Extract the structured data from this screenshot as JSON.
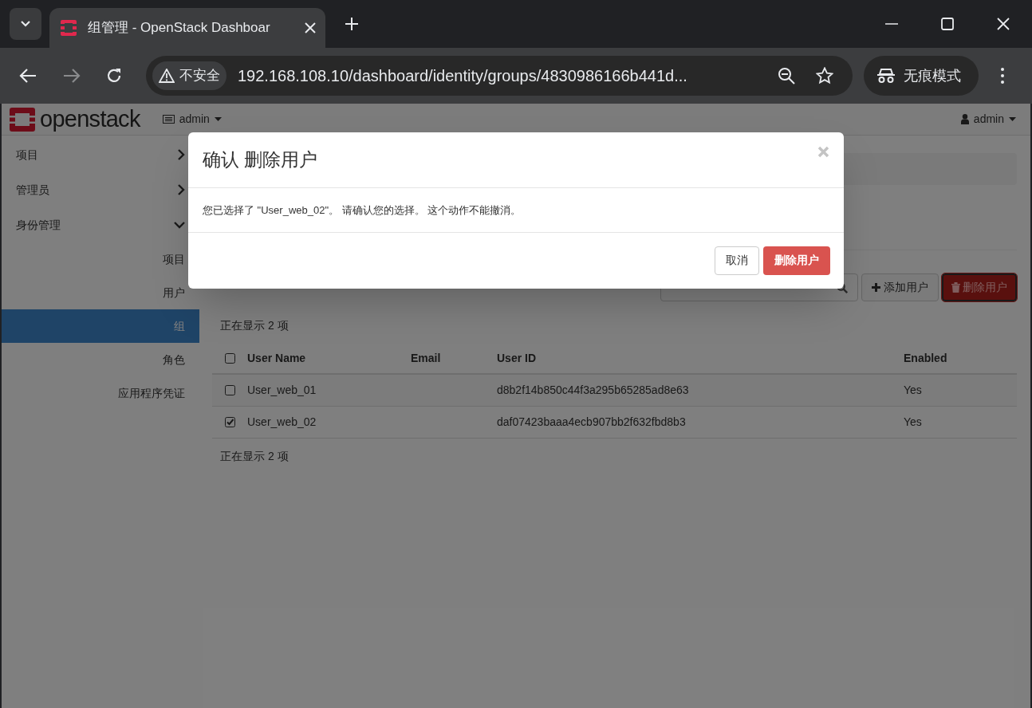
{
  "browser": {
    "tab_title": "组管理 - OpenStack Dashboar",
    "security_label": "不安全",
    "url": "192.168.108.10/dashboard/identity/groups/4830986166b441d...",
    "incognito_label": "无痕模式"
  },
  "header": {
    "logo_text": "openstack",
    "project_menu": "admin",
    "user_menu": "admin"
  },
  "sidebar": {
    "items": [
      {
        "label": "项目",
        "expanded": false
      },
      {
        "label": "管理员",
        "expanded": false
      },
      {
        "label": "身份管理",
        "expanded": true,
        "children": [
          {
            "label": "项目",
            "selected": false
          },
          {
            "label": "用户",
            "selected": false
          },
          {
            "label": "组",
            "selected": true
          },
          {
            "label": "角色",
            "selected": false
          },
          {
            "label": "应用程序凭证",
            "selected": false
          }
        ]
      }
    ]
  },
  "toolbar": {
    "buttons": [
      {
        "kind": "add",
        "label": "添加用户"
      },
      {
        "kind": "delete",
        "label": "删除用户"
      }
    ]
  },
  "table": {
    "count_top": "正在显示 2 项",
    "select_all_checked": false,
    "columns": [
      "User Name",
      "Email",
      "User ID",
      "Enabled"
    ],
    "rows": [
      {
        "selected": false,
        "user_name": "User_web_01",
        "user_id": "d8b2f14b850c44f3a295b65285ad8e63",
        "enabled": "Yes"
      },
      {
        "selected": true,
        "user_name": "User_web_02",
        "user_id": "daf07423baaa4ecb907bb2f632fbd8b3",
        "enabled": "Yes"
      }
    ],
    "count_bottom": "正在显示 2 项"
  },
  "modal": {
    "title": "确认 删除用户",
    "message": "您已选择了 \"User_web_02\"。 请确认您的选择。 这个动作不能撤消。",
    "buttons": [
      {
        "kind": "cancel",
        "label": "取消"
      },
      {
        "kind": "danger",
        "label": "删除用户"
      }
    ]
  }
}
